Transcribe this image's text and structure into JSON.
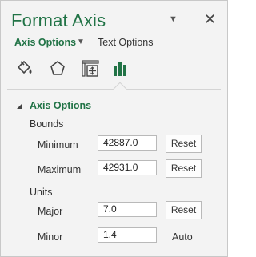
{
  "pane": {
    "title": "Format Axis",
    "pin_icon": "dropdown-triangle",
    "close_icon": "close-x"
  },
  "tabs": {
    "axis_options": "Axis Options",
    "text_options": "Text Options"
  },
  "icons": [
    "fill-line-icon",
    "effects-pentagon-icon",
    "size-properties-icon",
    "axis-options-bar-chart-icon"
  ],
  "section": {
    "title": "Axis Options"
  },
  "bounds": {
    "label": "Bounds",
    "minimum": {
      "label": "Minimum",
      "value": "42887.0",
      "button": "Reset"
    },
    "maximum": {
      "label": "Maximum",
      "value": "42931.0",
      "button": "Reset"
    }
  },
  "units": {
    "label": "Units",
    "major": {
      "label": "Major",
      "value": "7.0",
      "button": "Reset"
    },
    "minor": {
      "label": "Minor",
      "value": "1.4",
      "status": "Auto"
    }
  },
  "colors": {
    "accent": "#217346",
    "pane_bg": "#f3f3f3",
    "border": "#b9b9b9"
  }
}
